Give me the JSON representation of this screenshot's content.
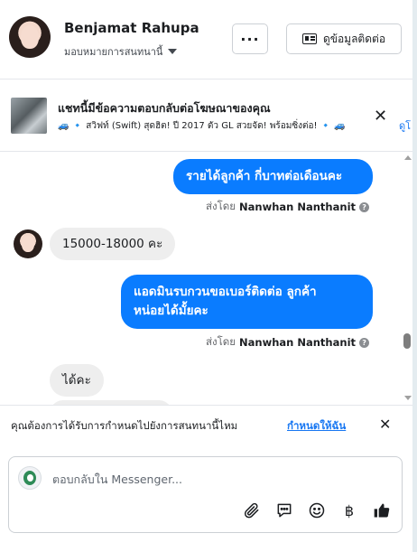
{
  "header": {
    "name": "Benjamat Rahupa",
    "assign_label": "มอบหมายการสนทนานี้",
    "more_label": "···",
    "contact_button_label": "ดูข้อมูลติดต่อ"
  },
  "ad_strip": {
    "title": "แชทนี้มีข้อความตอบกลับต่อโฆษณาของคุณ",
    "subtitle": "🚙 🔹 สวิฟท์ (Swift) สุดฮิต! ปี 2017 ตัว GL สวยจัด! พร้อมซิ่งต่อ! 🔹 🚙",
    "link_text": "ดูโ",
    "close_label": "✕"
  },
  "messages": [
    {
      "id": "m1",
      "direction": "outgoing",
      "text": "รายได้ลูกค้า  กี่บาทต่อเดือนคะ",
      "sent_by_prefix": "ส่งโดย",
      "sent_by_name": "Nanwhan Nanthanit"
    },
    {
      "id": "m2",
      "direction": "incoming",
      "text": "15000-18000 คะ"
    },
    {
      "id": "m3",
      "direction": "outgoing",
      "lines": [
        "แอดมินรบกวนขอเบอร์ติดต่อ ลูกค้า",
        "หน่อยได้มั้ยคะ"
      ],
      "sent_by_prefix": "ส่งโดย",
      "sent_by_name": "Nanwhan Nanthanit"
    },
    {
      "id": "m4",
      "direction": "incoming",
      "text": "ได้คะ"
    }
  ],
  "notice": {
    "text": "คุณต้องการได้รับการกำหนดไปยังการสนทนานี้ไหม",
    "link_text": "กำหนดให้ฉัน",
    "close_label": "✕"
  },
  "composer": {
    "placeholder": "ตอบกลับใน Messenger...",
    "baht_symbol": "฿"
  },
  "icons": {
    "attach": "paperclip-icon",
    "saved_replies": "chat-bubble-icon",
    "emoji": "smiley-icon",
    "payment": "baht-icon",
    "like": "thumbs-up-icon"
  },
  "colors": {
    "outgoing_bubble": "#0a7cff",
    "incoming_bubble": "#eeeeee",
    "link": "#1877f2"
  }
}
